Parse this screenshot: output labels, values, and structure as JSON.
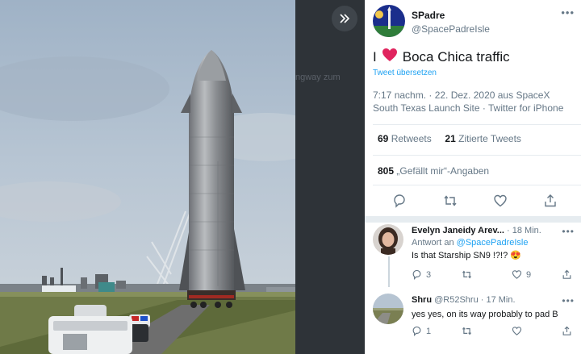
{
  "tweet": {
    "display_name": "SPadre",
    "handle": "@SpacePadreIsle",
    "text_before": "I",
    "text_after": "Boca Chica traffic",
    "translate_label": "Tweet übersetzen",
    "time_line": "7:17 nachm. · 22. Dez. 2020 aus SpaceX",
    "place_line": "South Texas Launch Site · Twitter for iPhone",
    "retweets_count": "69",
    "retweets_label": "Retweets",
    "quotes_count": "21",
    "quotes_label": "Zitierte Tweets",
    "likes_count": "805",
    "likes_label": "„Gefällt mir“-Angaben",
    "more": "•••"
  },
  "replies": [
    {
      "name": "Evelyn Janeidy Arev...",
      "time": "· 18 Min.",
      "reply_to_prefix": "Antwort an",
      "reply_to_handle": "@SpacePadreIsle",
      "text": "Is that Starship SN9 !?!?",
      "emoji": "😍",
      "reply_count": "3",
      "retweet_count": "",
      "like_count": "9",
      "more": "•••"
    },
    {
      "name": "Shru",
      "handle_time": "@R52Shru · 17 Min.",
      "text": "yes yes, on its way probably to pad B",
      "reply_count": "1",
      "retweet_count": "",
      "like_count": "",
      "more": "•••"
    }
  ],
  "background": {
    "ghost_text": "ngway zum"
  },
  "colors": {
    "accent": "#1da1f2",
    "heart": "#e0245e",
    "secondary_text": "#657786",
    "primary_text": "#14171a"
  },
  "icons": [
    "chevron-double-right-icon",
    "heart-emoji-icon",
    "reply-icon",
    "retweet-icon",
    "like-icon",
    "share-icon"
  ]
}
